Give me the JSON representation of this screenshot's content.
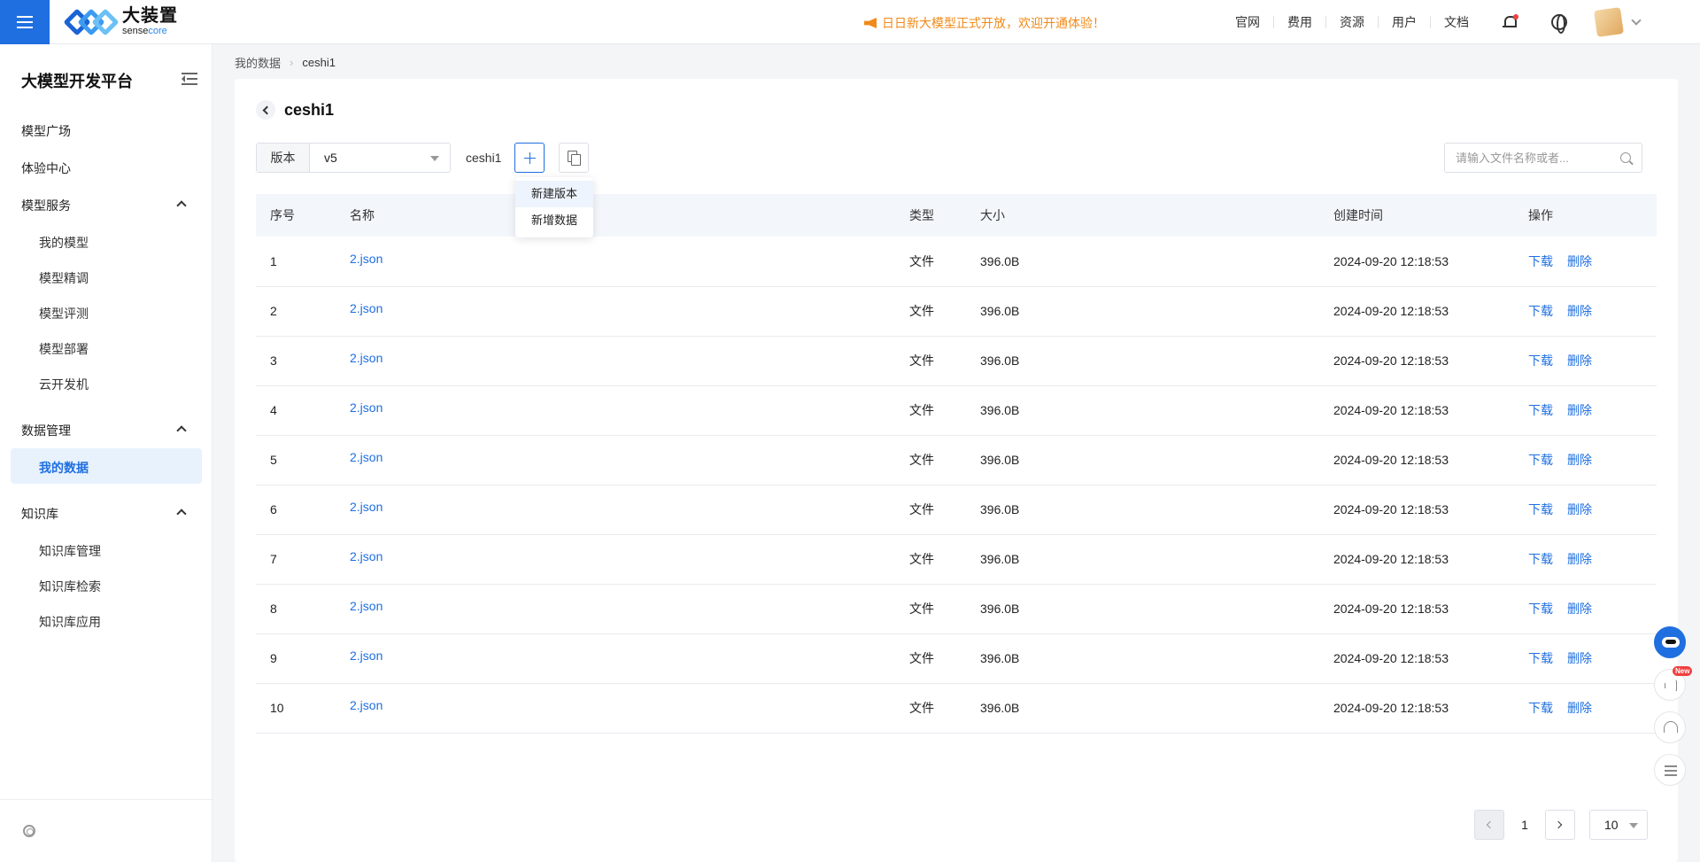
{
  "header": {
    "brand_cn": "大装置",
    "brand_en_a": "sense",
    "brand_en_b": "core",
    "announcement": "日日新大模型正式开放，欢迎开通体验！",
    "nav": [
      "官网",
      "费用",
      "资源",
      "用户",
      "文档"
    ],
    "icons": [
      "menu-icon",
      "bell-icon",
      "globe-icon",
      "avatar",
      "chevron-down-icon"
    ]
  },
  "sidebar": {
    "title": "大模型开发平台",
    "items": {
      "model_square": "模型广场",
      "experience": "体验中心",
      "model_service": "模型服务",
      "my_models": "我的模型",
      "finetune": "模型精调",
      "evaluate": "模型评测",
      "deploy": "模型部署",
      "cloud_dev": "云开发机",
      "data_mgmt": "数据管理",
      "my_data": "我的数据",
      "kb": "知识库",
      "kb_manage": "知识库管理",
      "kb_search": "知识库检索",
      "kb_apply": "知识库应用"
    }
  },
  "breadcrumb": {
    "root": "我的数据",
    "current": "ceshi1"
  },
  "page": {
    "title": "ceshi1",
    "version_label": "版本",
    "version_value": "v5",
    "dataset_name": "ceshi1",
    "dropdown": [
      "新建版本",
      "新增数据"
    ],
    "search_placeholder": "请输入文件名称或者..."
  },
  "table": {
    "headers": {
      "index": "序号",
      "name": "名称",
      "type": "类型",
      "size": "大小",
      "created": "创建时间",
      "ops": "操作"
    },
    "rows": [
      {
        "index": "1",
        "name": "2.json",
        "type": "文件",
        "size": "396.0B",
        "created": "2024-09-20 12:18:53",
        "download": "下载",
        "delete": "删除"
      },
      {
        "index": "2",
        "name": "2.json",
        "type": "文件",
        "size": "396.0B",
        "created": "2024-09-20 12:18:53",
        "download": "下载",
        "delete": "删除"
      },
      {
        "index": "3",
        "name": "2.json",
        "type": "文件",
        "size": "396.0B",
        "created": "2024-09-20 12:18:53",
        "download": "下载",
        "delete": "删除"
      },
      {
        "index": "4",
        "name": "2.json",
        "type": "文件",
        "size": "396.0B",
        "created": "2024-09-20 12:18:53",
        "download": "下载",
        "delete": "删除"
      },
      {
        "index": "5",
        "name": "2.json",
        "type": "文件",
        "size": "396.0B",
        "created": "2024-09-20 12:18:53",
        "download": "下载",
        "delete": "删除"
      },
      {
        "index": "6",
        "name": "2.json",
        "type": "文件",
        "size": "396.0B",
        "created": "2024-09-20 12:18:53",
        "download": "下载",
        "delete": "删除"
      },
      {
        "index": "7",
        "name": "2.json",
        "type": "文件",
        "size": "396.0B",
        "created": "2024-09-20 12:18:53",
        "download": "下载",
        "delete": "删除"
      },
      {
        "index": "8",
        "name": "2.json",
        "type": "文件",
        "size": "396.0B",
        "created": "2024-09-20 12:18:53",
        "download": "下载",
        "delete": "删除"
      },
      {
        "index": "9",
        "name": "2.json",
        "type": "文件",
        "size": "396.0B",
        "created": "2024-09-20 12:18:53",
        "download": "下载",
        "delete": "删除"
      },
      {
        "index": "10",
        "name": "2.json",
        "type": "文件",
        "size": "396.0B",
        "created": "2024-09-20 12:18:53",
        "download": "下载",
        "delete": "删除"
      }
    ]
  },
  "pagination": {
    "current": "1",
    "page_size": "10"
  },
  "floating_tools": {
    "new_badge": "New"
  },
  "colors": {
    "accent": "#1f6fe0",
    "announcement": "#f08a1a",
    "active_bg": "#e8f2fd"
  }
}
